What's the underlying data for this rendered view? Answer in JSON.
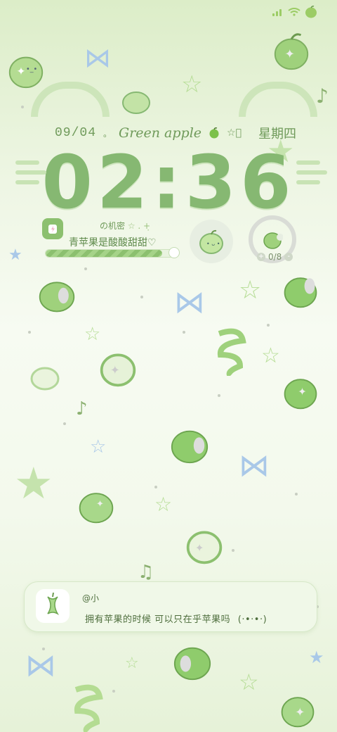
{
  "status_bar": {
    "battery_icon": "apple-battery-icon",
    "wifi_icon": "wifi-icon",
    "signal_icon": "signal-icon"
  },
  "lockscreen": {
    "date": "09/04",
    "date_suffix": "。",
    "brand_text": "Green apple",
    "brand_suffix": "☆゚",
    "weekday": "星期四",
    "time": "02:36"
  },
  "widget_left": {
    "icon": "lightning-battery-icon",
    "secret_label": "の机密",
    "secret_suffix": "☆ . +̣",
    "caption": "青苹果是酸酸甜甜♡",
    "progress_fraction": 0.9
  },
  "widget_apple": {
    "icon": "green-apple-icon"
  },
  "widget_counter": {
    "icon": "bitten-apple-icon",
    "minus": "-",
    "plus": "+",
    "value": "0/8"
  },
  "notification": {
    "icon": "apple-core-icon",
    "sender": "@小",
    "body": "拥有苹果的时候 可以只在乎苹果吗",
    "emoticon": "(·•·•·)"
  },
  "colors": {
    "accent": "#86b872",
    "text": "#5e8a4b",
    "bg_top": "#dcedc8",
    "bow": "#a9c8e8"
  }
}
